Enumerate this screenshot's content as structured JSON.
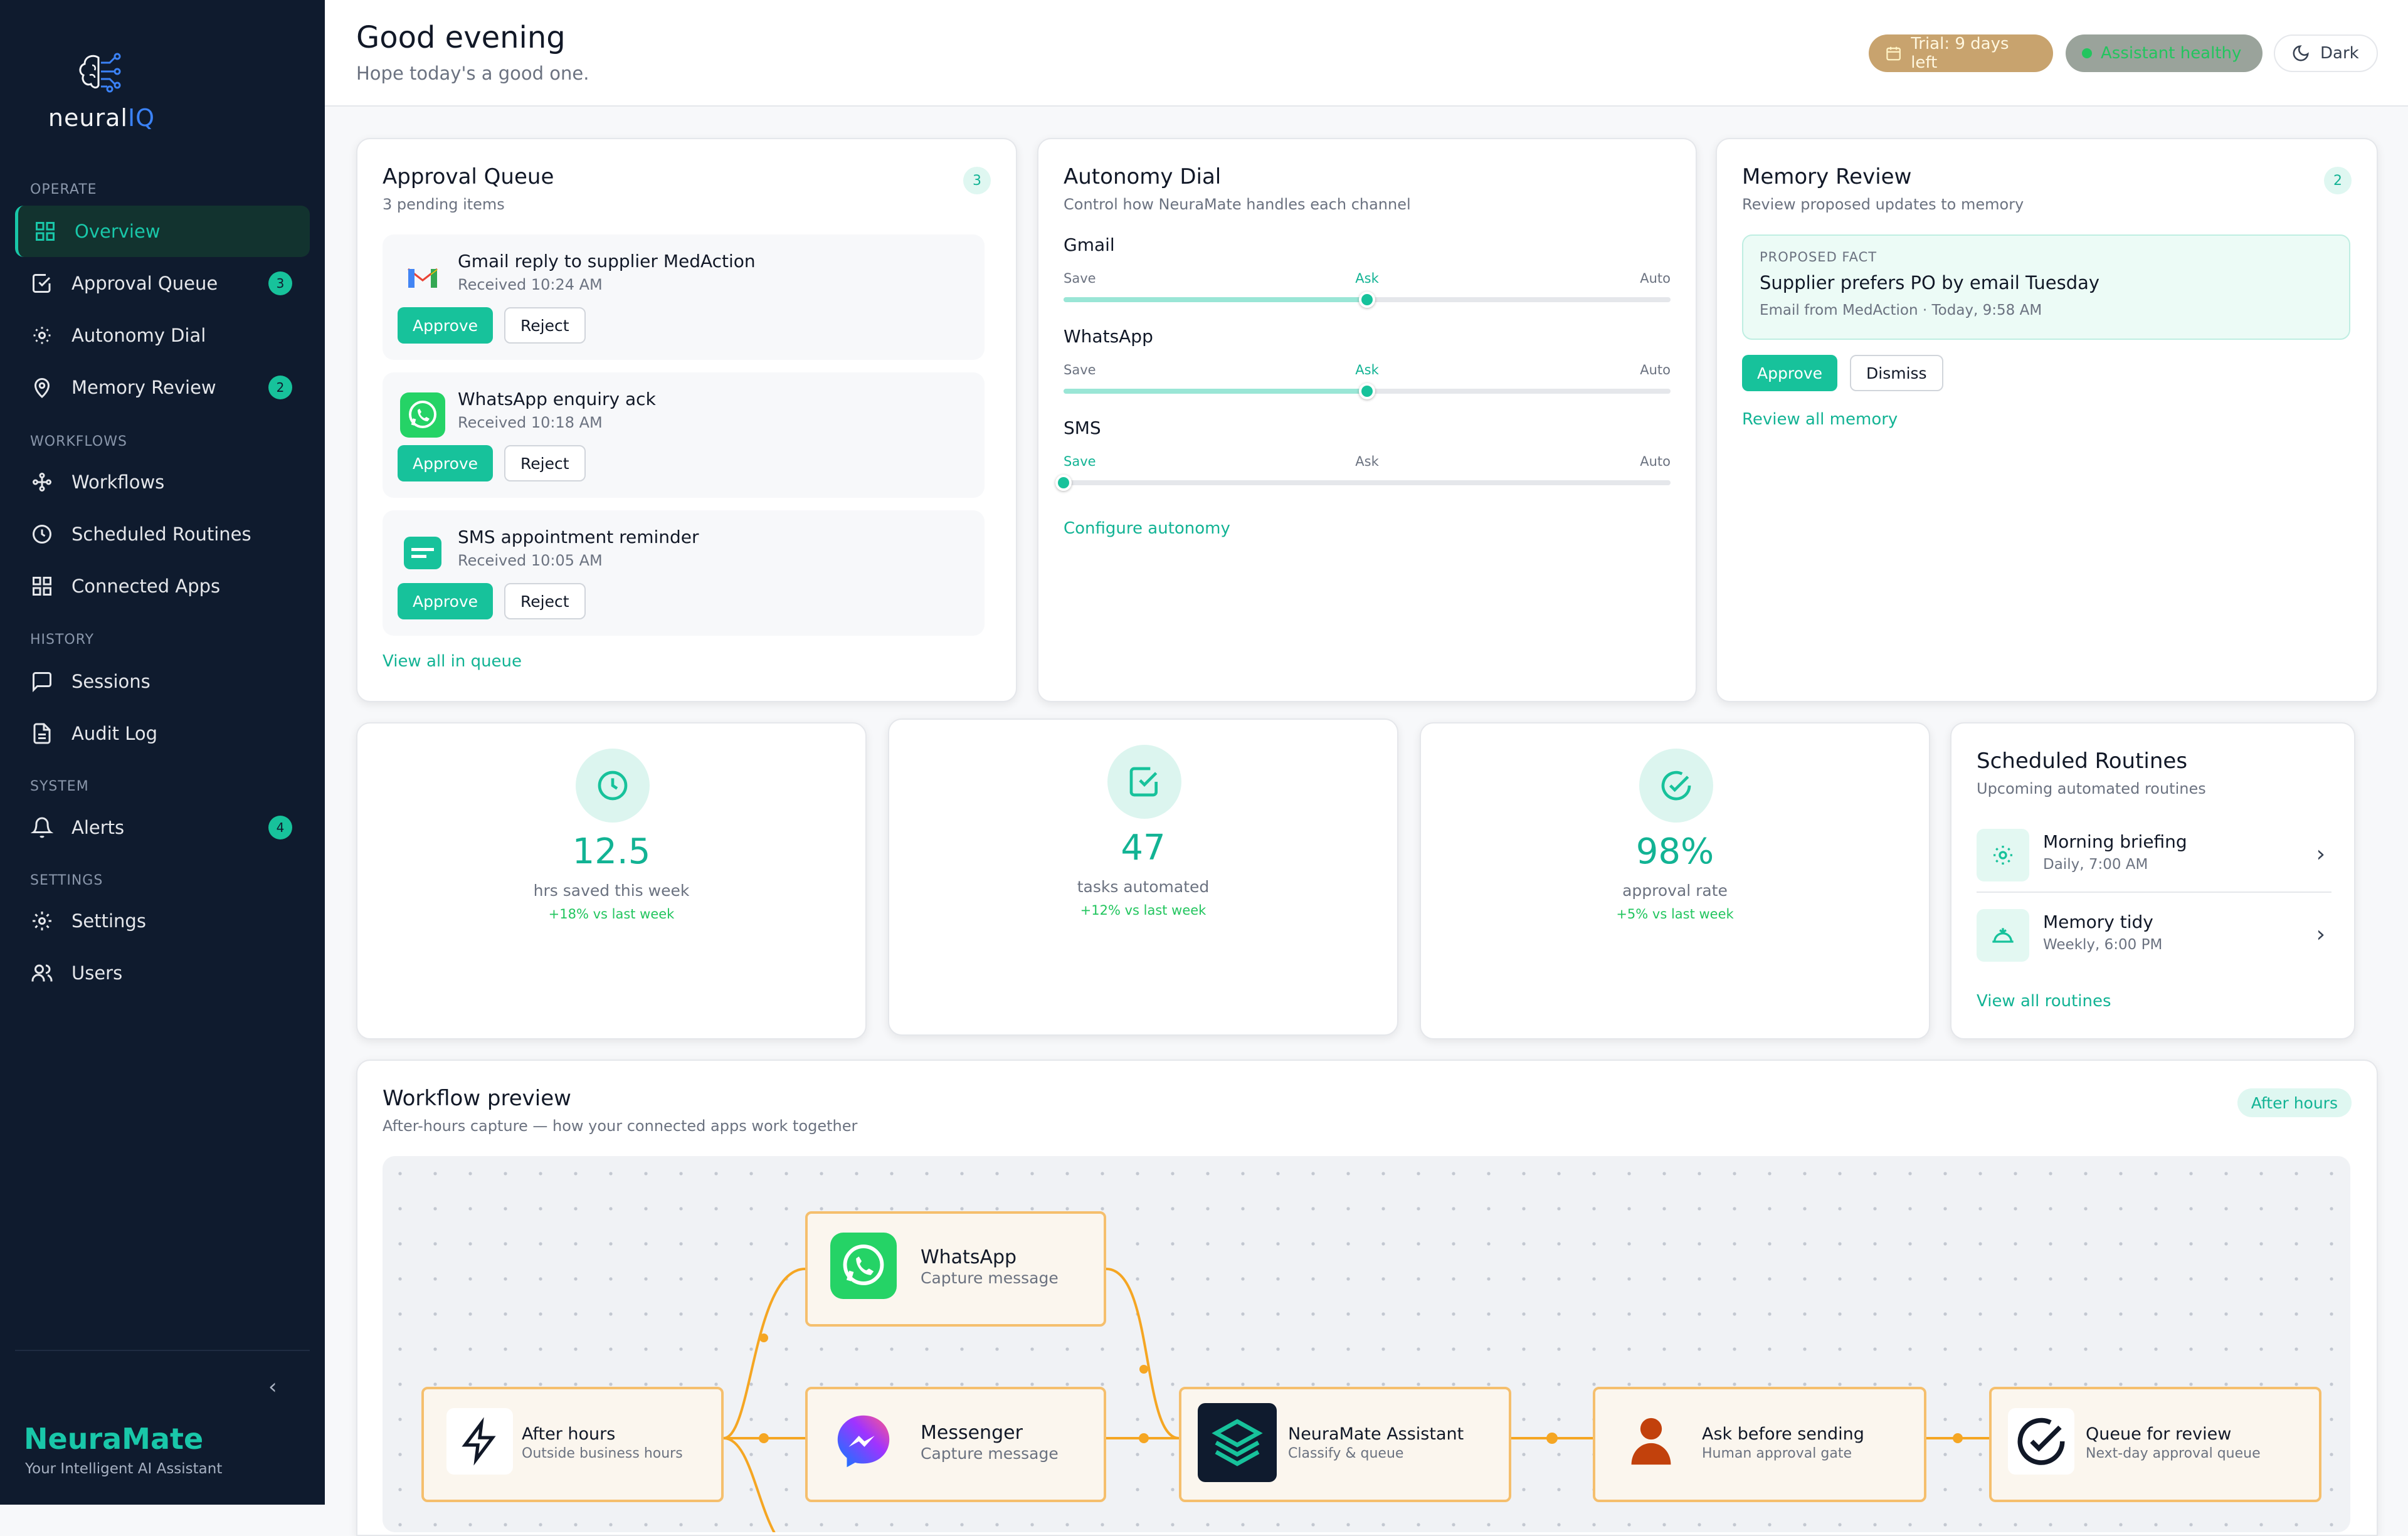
{
  "sidebar": {
    "logo_text_a": "neural",
    "logo_text_b": "Q",
    "sections": {
      "operate": "OPERATE",
      "workflows": "WORKFLOWS",
      "history": "HISTORY",
      "system": "SYSTEM",
      "settings": "SETTINGS"
    },
    "items": {
      "overview": "Overview",
      "approval_queue": "Approval Queue",
      "approval_queue_badge": "3",
      "autonomy_dial": "Autonomy Dial",
      "memory_review": "Memory Review",
      "memory_review_badge": "2",
      "workflows": "Workflows",
      "scheduled_routines": "Scheduled Routines",
      "connected_apps": "Connected Apps",
      "sessions": "Sessions",
      "audit_log": "Audit Log",
      "alerts": "Alerts",
      "alerts_badge": "4",
      "settings": "Settings",
      "users": "Users"
    },
    "collapse_icon": "chevron-left-icon",
    "brand": "NeuraMate",
    "brand_sub": "Your Intelligent AI Assistant"
  },
  "header": {
    "title": "Good evening",
    "subtitle": "Hope today's a good one.",
    "trial": "Trial: 9 days left",
    "health": "Assistant healthy",
    "theme": "Dark"
  },
  "approval_queue": {
    "title": "Approval Queue",
    "subtitle": "3 pending items",
    "count": "3",
    "items": [
      {
        "title": "Gmail reply to supplier MedAction",
        "time": "Received 10:24 AM",
        "icon": "gmail-icon"
      },
      {
        "title": "WhatsApp enquiry ack",
        "time": "Received 10:18 AM",
        "icon": "whatsapp-icon"
      },
      {
        "title": "SMS appointment reminder",
        "time": "Received 10:05 AM",
        "icon": "sms-icon"
      }
    ],
    "approve": "Approve",
    "reject": "Reject",
    "view_all": "View all in queue"
  },
  "autonomy": {
    "title": "Autonomy Dial",
    "subtitle": "Control how NeuraMate handles each channel",
    "levels": [
      "Save",
      "Ask",
      "Auto"
    ],
    "channels": [
      {
        "name": "Gmail",
        "level": "Ask",
        "value": 0.5
      },
      {
        "name": "WhatsApp",
        "level": "Ask",
        "value": 0.5
      },
      {
        "name": "SMS",
        "level": "Save",
        "value": 0.0
      }
    ],
    "configure": "Configure autonomy"
  },
  "memory": {
    "title": "Memory Review",
    "subtitle": "Review proposed updates to memory",
    "count": "2",
    "fact_label": "PROPOSED FACT",
    "fact": "Supplier prefers PO by email Tuesday",
    "fact_source": "Email from MedAction · Today, 9:58 AM",
    "approve": "Approve",
    "dismiss": "Dismiss",
    "review_all": "Review all memory"
  },
  "stats": [
    {
      "value": "12.5",
      "label": "hrs saved this week",
      "delta": "+18% vs last week",
      "icon": "clock-icon"
    },
    {
      "value": "47",
      "label": "tasks automated",
      "delta": "+12% vs last week",
      "icon": "check-square-icon"
    },
    {
      "value": "98%",
      "label": "approval rate",
      "delta": "+5% vs last week",
      "icon": "check-circle-icon"
    }
  ],
  "routines": {
    "title": "Scheduled Routines",
    "subtitle": "Upcoming automated routines",
    "items": [
      {
        "name": "Morning briefing",
        "schedule": "Daily, 7:00 AM",
        "icon": "sun-icon"
      },
      {
        "name": "Memory tidy",
        "schedule": "Weekly, 6:00 PM",
        "icon": "sunset-icon"
      }
    ],
    "view_all": "View all routines"
  },
  "workflow": {
    "title": "Workflow preview",
    "subtitle": "After-hours capture — how your connected apps work together",
    "tag": "After hours",
    "nodes": {
      "after_hours": {
        "title": "After hours",
        "sub": "Outside business hours"
      },
      "whatsapp": {
        "title": "WhatsApp",
        "sub": "Capture message"
      },
      "messenger": {
        "title": "Messenger",
        "sub": "Capture message"
      },
      "assistant": {
        "title": "NeuraMate Assistant",
        "sub": "Classify & queue"
      },
      "ask": {
        "title": "Ask before sending",
        "sub": "Human approval gate"
      },
      "queue": {
        "title": "Queue for review",
        "sub": "Next-day approval queue"
      }
    }
  },
  "colors": {
    "accent": "#17c29b",
    "sidebar": "#0f1b2e",
    "flow": "#f5a623",
    "trial_bg": "#c8a36e",
    "health_bg": "#9aa39b"
  }
}
